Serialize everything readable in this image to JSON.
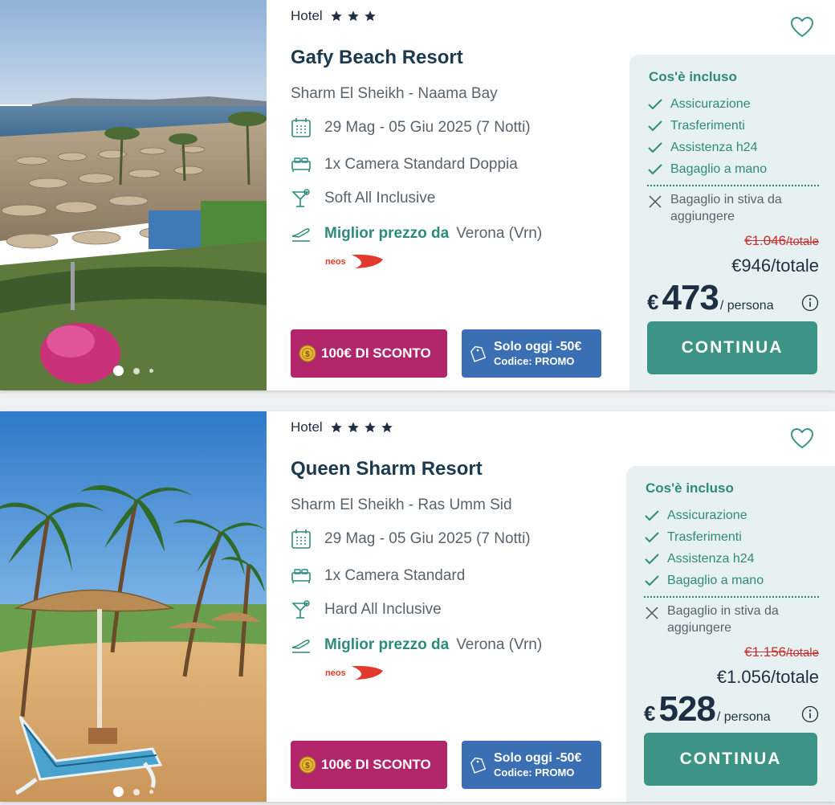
{
  "colors": {
    "accent": "#3d9486",
    "discount": "#b1256b",
    "promo": "#3b6fb3",
    "old_price": "#c62f2f",
    "panel": "#e7f1f1"
  },
  "results": [
    {
      "hotel_label": "Hotel",
      "stars": 3,
      "name": "Gafy Beach Resort",
      "location": "Sharm El Sheikh - Naama Bay",
      "dates": "29 Mag - 05 Giu 2025 (7 Notti)",
      "room": "1x Camera Standard Doppia",
      "board": "Soft All Inclusive",
      "best_price_label": "Miglior prezzo da",
      "departure": "Verona (Vrn)",
      "airline": "neos",
      "discount_badge": "100€ DI SCONTO",
      "promo_main": "Solo oggi -50€",
      "promo_code": "Codice: PROMO",
      "included_title": "Cos'è incluso",
      "included": [
        "Assicurazione",
        "Trasferimenti",
        "Assistenza h24",
        "Bagaglio a mano"
      ],
      "excluded": "Bagaglio in stiva da aggiungere",
      "old_price": "€1.046",
      "old_price_unit": "/totale",
      "total_price": "€946/totale",
      "currency": "€",
      "per_person_amount": "473",
      "per_person_label": "/ persona",
      "cta": "CONTINUA"
    },
    {
      "hotel_label": "Hotel",
      "stars": 4,
      "name": "Queen Sharm Resort",
      "location": "Sharm El Sheikh - Ras Umm Sid",
      "dates": "29 Mag - 05 Giu 2025 (7 Notti)",
      "room": "1x Camera Standard",
      "board": "Hard All Inclusive",
      "best_price_label": "Miglior prezzo da",
      "departure": "Verona (Vrn)",
      "airline": "neos",
      "discount_badge": "100€ DI SCONTO",
      "promo_main": "Solo oggi -50€",
      "promo_code": "Codice: PROMO",
      "included_title": "Cos'è incluso",
      "included": [
        "Assicurazione",
        "Trasferimenti",
        "Assistenza h24",
        "Bagaglio a mano"
      ],
      "excluded": "Bagaglio in stiva da aggiungere",
      "old_price": "€1.156",
      "old_price_unit": "/totale",
      "total_price": "€1.056/totale",
      "currency": "€",
      "per_person_amount": "528",
      "per_person_label": "/ persona",
      "cta": "CONTINUA"
    }
  ]
}
